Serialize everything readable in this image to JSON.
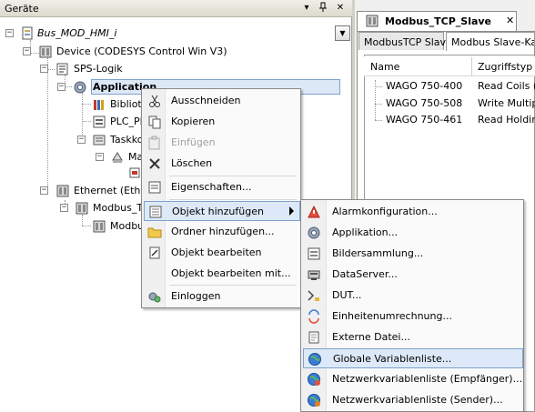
{
  "devices_panel": {
    "title": "Geräte",
    "dropdown_symbol": "▾",
    "pin_symbol": "ᵖ",
    "close_symbol": "✕"
  },
  "tree": {
    "project": "Bus_MOD_HMI_i",
    "device": "Device (CODESYS Control Win V3)",
    "plc_logic": "SPS-Logik",
    "application": "Application",
    "library": "Biblioth",
    "plc_prg": "PLC_PF",
    "task_config": "Taskko",
    "main_task": "Ma",
    "ethernet": "Ethernet (Ether",
    "modbus_tcp": "Modbus_TC",
    "modbus_slave": "Modbu"
  },
  "editor": {
    "doc_tab": "Modbus_TCP_Slave",
    "doc_close": "✕",
    "inner_tabs": [
      "ModbusTCP Slave",
      "Modbus Slave-Kana"
    ],
    "columns": [
      "Name",
      "Zugriffstyp"
    ],
    "rows": [
      {
        "name": "WAGO 750-400",
        "type": "Read Coils (F"
      },
      {
        "name": "WAGO 750-508",
        "type": "Write Multiple"
      },
      {
        "name": "WAGO 750-461",
        "type": "Read Holding"
      }
    ]
  },
  "context_menu": {
    "cut": "Ausschneiden",
    "copy": "Kopieren",
    "paste": "Einfügen",
    "delete": "Löschen",
    "properties": "Eigenschaften...",
    "add_object": "Objekt hinzufügen",
    "add_folder": "Ordner hinzufügen...",
    "edit_object": "Objekt bearbeiten",
    "edit_object_with": "Objekt bearbeiten mit...",
    "login": "Einloggen"
  },
  "submenu": {
    "items": [
      "Alarmkonfiguration...",
      "Applikation...",
      "Bildersammlung...",
      "DataServer...",
      "DUT...",
      "Einheitenumrechnung...",
      "Externe Datei...",
      "Globale Variablenliste...",
      "Netzwerkvariablenliste (Empfänger)...",
      "Netzwerkvariablenliste (Sender)..."
    ],
    "highlighted": "Globale Variablenliste..."
  },
  "colors": {
    "selection_bg": "#dde8f7",
    "selection_border": "#7da2ce",
    "menu_bg": "#fafafa",
    "panel_bg": "#d4d0c8"
  },
  "icons": {
    "project": "project-file-icon",
    "device": "device-icon",
    "plc_logic": "plc-logic-icon",
    "application": "gear-icon",
    "library": "library-icon",
    "pou": "pou-icon",
    "task": "task-config-icon",
    "ethernet": "ethernet-icon",
    "cut": "scissors-icon",
    "copy": "copy-icon",
    "paste": "paste-icon",
    "delete": "delete-x-icon",
    "properties": "properties-icon",
    "add_object": "add-object-icon",
    "folder": "folder-icon",
    "edit": "edit-icon",
    "login": "login-icon",
    "globe": "globe-icon"
  }
}
